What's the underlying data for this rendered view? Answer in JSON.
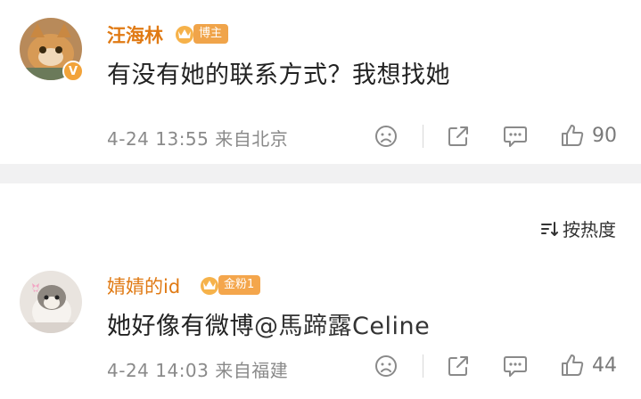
{
  "comments": [
    {
      "username": "汪海林",
      "badge": "博主",
      "verified_mark": "V",
      "text": "有没有她的联系方式？我想找她",
      "meta": "4-24 13:55 来自北京",
      "likes": "90"
    },
    {
      "username": "婧婧的id",
      "badge": "金粉1",
      "text_before_mention": "她好像有微博",
      "mention": "@馬蹄露Celine",
      "meta": "4-24 14:03 来自福建",
      "likes": "44"
    }
  ],
  "sort": {
    "label": "按热度"
  },
  "colors": {
    "username": "#e07a14",
    "badge": "#f0a44a",
    "meta": "#8a8a8a",
    "separator": "#f1f1f2"
  },
  "icons": [
    "sad-face-icon",
    "repost-icon",
    "comment-icon",
    "thumbs-up-icon",
    "sort-icon",
    "crown-icon"
  ]
}
